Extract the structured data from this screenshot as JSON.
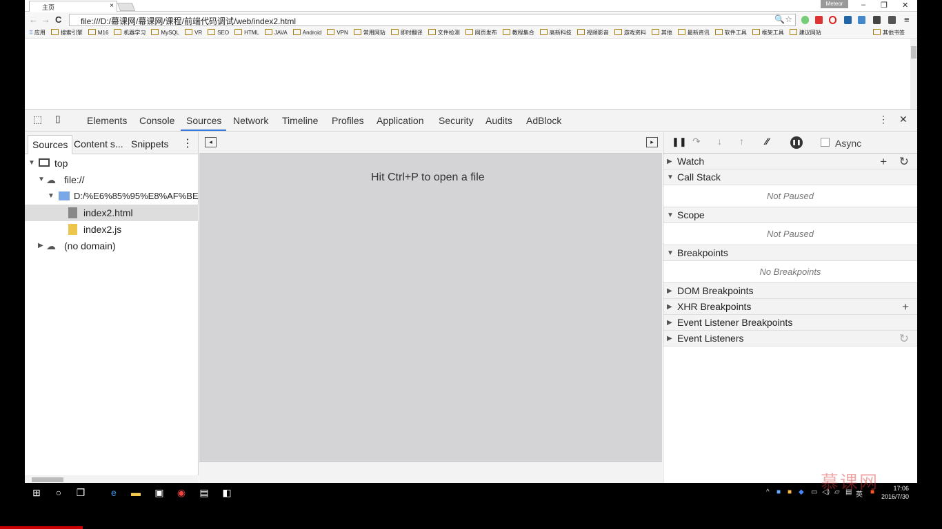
{
  "browser": {
    "tab_title": "主页",
    "user": "Meteor",
    "url": "file:///D:/幕课网/幕课网/课程/前端代码调试/web/index2.html",
    "bookmarks": [
      "应用",
      "搜索引擎",
      "M16",
      "机器学习",
      "MySQL",
      "VR",
      "SEO",
      "HTML",
      "JAVA",
      "Android",
      "VPN",
      "常用网站",
      "即时翻译",
      "文件检测",
      "网页发布",
      "教程集合",
      "高新科技",
      "视频影音",
      "游戏资料",
      "其他",
      "最新资讯",
      "软件工具",
      "框架工具",
      "建议网站"
    ],
    "other_bookmarks": "其他书签"
  },
  "devtools": {
    "tabs": [
      "Elements",
      "Console",
      "Sources",
      "Network",
      "Timeline",
      "Profiles",
      "Application",
      "Security",
      "Audits",
      "AdBlock"
    ],
    "active_tab": "Sources",
    "navigator_tabs": [
      "Sources",
      "Content s...",
      "Snippets"
    ],
    "tree": {
      "top": "top",
      "file": "file://",
      "folder": "D:/%E6%85%95%E8%AF%BE%",
      "file1": "index2.html",
      "file2": "index2.js",
      "nodomain": "(no domain)"
    },
    "hint": "Hit Ctrl+P to open a file",
    "async_label": "Async",
    "panes": {
      "watch": "Watch",
      "callstack": "Call Stack",
      "not_paused": "Not Paused",
      "scope": "Scope",
      "breakpoints": "Breakpoints",
      "no_breakpoints": "No Breakpoints",
      "dom": "DOM Breakpoints",
      "xhr": "XHR Breakpoints",
      "event_listener_bp": "Event Listener Breakpoints",
      "event_listeners": "Event Listeners"
    }
  },
  "taskbar": {
    "time": "17:06",
    "date": "2016/7/30",
    "ime": "英"
  },
  "watermark": "慕课网"
}
